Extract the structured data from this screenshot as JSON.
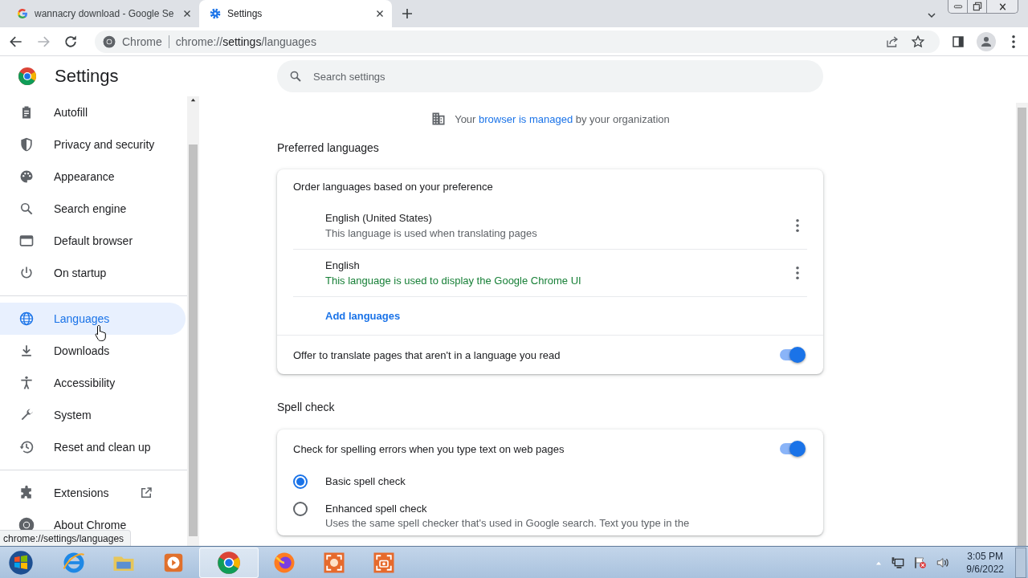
{
  "browser_tabs": [
    {
      "title": "wannacry download - Google Se",
      "selected": false
    },
    {
      "title": "Settings",
      "selected": true
    }
  ],
  "address_bar": {
    "site_label": "Chrome",
    "url_scheme": "chrome://",
    "url_host": "settings",
    "url_path": "/languages"
  },
  "settings_title": "Settings",
  "search": {
    "placeholder": "Search settings"
  },
  "sidebar": {
    "groups": [
      [
        {
          "label": "Autofill",
          "selected": false,
          "kind": "page"
        },
        {
          "label": "Privacy and security",
          "selected": false,
          "kind": "page"
        },
        {
          "label": "Appearance",
          "selected": false,
          "kind": "page"
        },
        {
          "label": "Search engine",
          "selected": false,
          "kind": "page"
        },
        {
          "label": "Default browser",
          "selected": false,
          "kind": "page"
        },
        {
          "label": "On startup",
          "selected": false,
          "kind": "page"
        }
      ],
      [
        {
          "label": "Languages",
          "selected": true,
          "kind": "page"
        },
        {
          "label": "Downloads",
          "selected": false,
          "kind": "page"
        },
        {
          "label": "Accessibility",
          "selected": false,
          "kind": "page"
        },
        {
          "label": "System",
          "selected": false,
          "kind": "page"
        },
        {
          "label": "Reset and clean up",
          "selected": false,
          "kind": "page"
        }
      ],
      [
        {
          "label": "Extensions",
          "selected": false,
          "kind": "external"
        },
        {
          "label": "About Chrome",
          "selected": false,
          "kind": "page"
        }
      ]
    ]
  },
  "managed_notice": {
    "before": "Your",
    "link": "browser is managed",
    "after": "by your organization"
  },
  "preferred_languages": {
    "title": "Preferred languages",
    "heading": "Order languages based on your preference",
    "languages": [
      {
        "name": "English (United States)",
        "description": "This language is used when translating pages",
        "ui_language": false
      },
      {
        "name": "English",
        "description": "This language is used to display the Google Chrome UI",
        "ui_language": true
      }
    ],
    "add_button": "Add languages",
    "translate_offer": {
      "label": "Offer to translate pages that aren't in a language you read",
      "on": true
    }
  },
  "spell_check": {
    "title": "Spell check",
    "toggle": {
      "label": "Check for spelling errors when you type text on web pages",
      "on": true
    },
    "options": [
      {
        "label": "Basic spell check",
        "selected": true
      },
      {
        "label": "Enhanced spell check",
        "selected": false,
        "description": "Uses the same spell checker that's used in Google search. Text you type in the"
      }
    ]
  },
  "status_tooltip": "chrome://settings/languages",
  "taskbar": {
    "apps": [
      {
        "selected": false
      },
      {
        "selected": false
      },
      {
        "selected": false
      },
      {
        "selected": true
      },
      {
        "selected": false
      },
      {
        "selected": false
      },
      {
        "selected": false
      }
    ],
    "time": "3:05 PM",
    "date": "9/6/2022"
  }
}
